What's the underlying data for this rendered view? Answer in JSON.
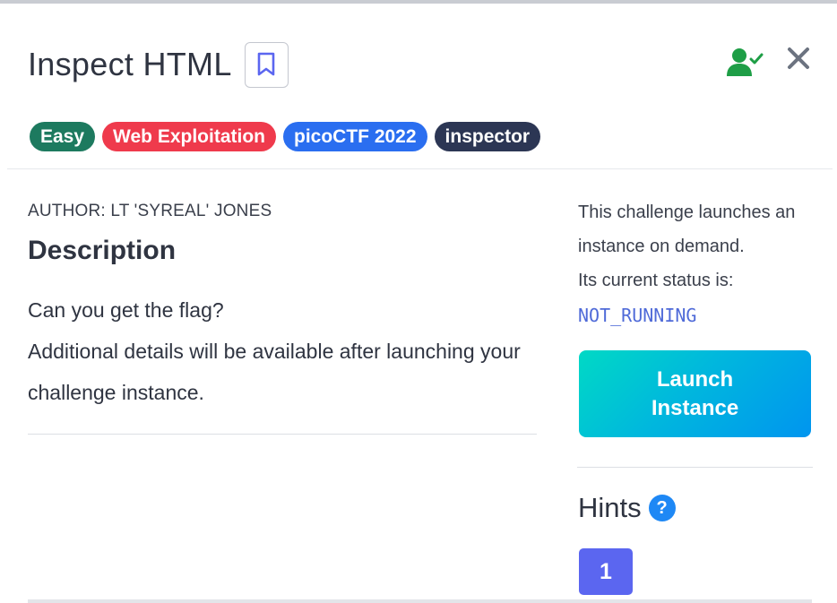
{
  "challenge": {
    "title": "Inspect HTML",
    "tags": [
      {
        "label": "Easy",
        "color": "#1d7a5f"
      },
      {
        "label": "Web Exploitation",
        "color": "#ef3a4c"
      },
      {
        "label": "picoCTF 2022",
        "color": "#2a6ef0"
      },
      {
        "label": "inspector",
        "color": "#2c3654"
      }
    ],
    "author": "AUTHOR: LT 'SYREAL' JONES",
    "description_heading": "Description",
    "description_lines": [
      "Can you get the flag?",
      "Additional details will be available after launching your challenge instance."
    ]
  },
  "instance": {
    "info_line_1": "This challenge launches an instance on demand.",
    "info_line_2": "Its current status is:",
    "status": "NOT_RUNNING",
    "launch_line_1": "Launch",
    "launch_line_2": "Instance"
  },
  "hints": {
    "heading": "Hints",
    "help_glyph": "?",
    "items": [
      {
        "label": "1"
      }
    ]
  },
  "colors": {
    "user_check_icon": "#1e9e46",
    "close_icon": "#6c7380",
    "status_text": "#4f6ad8",
    "hint_button": "#5b66f0"
  }
}
